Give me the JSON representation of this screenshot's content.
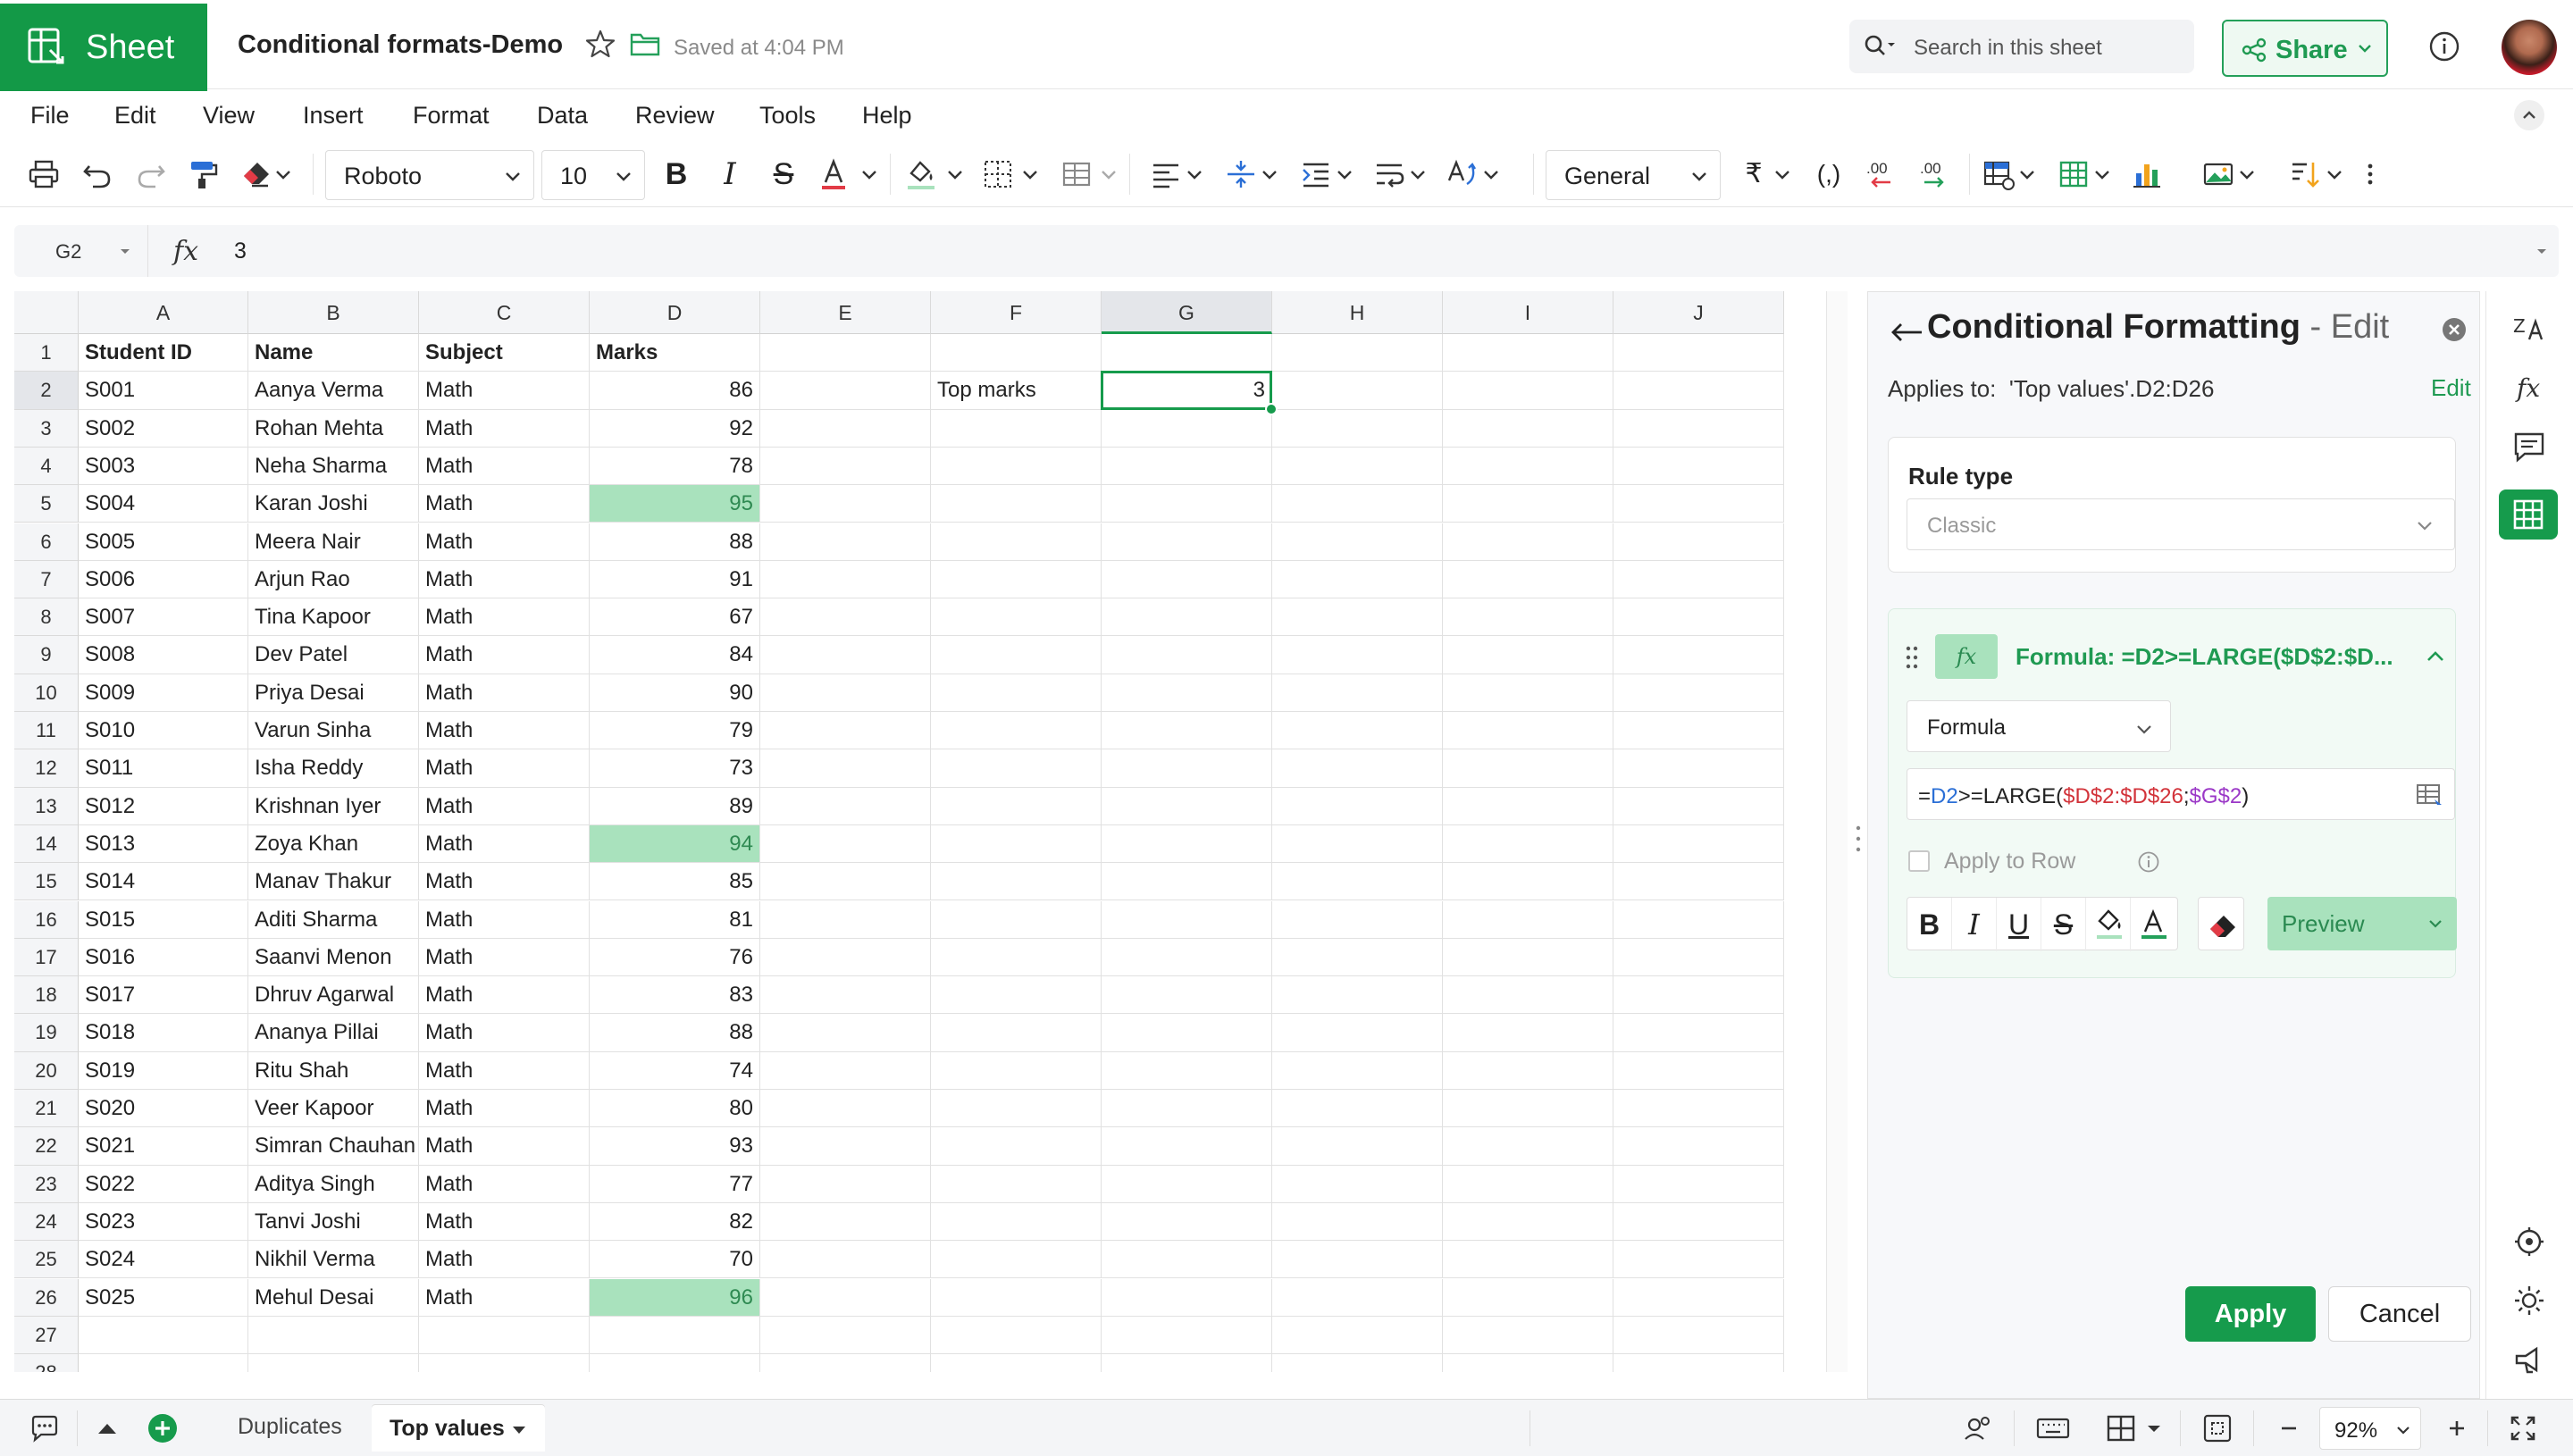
{
  "app": {
    "name": "Sheet",
    "doc_title": "Conditional formats-Demo",
    "saved_status": "Saved at 4:04 PM"
  },
  "search": {
    "placeholder": "Search in this sheet"
  },
  "share": {
    "label": "Share"
  },
  "menu": [
    "File",
    "Edit",
    "View",
    "Insert",
    "Format",
    "Data",
    "Review",
    "Tools",
    "Help"
  ],
  "toolbar": {
    "font": "Roboto",
    "font_size": "10",
    "number_format": "General"
  },
  "formula_bar": {
    "cell_ref": "G2",
    "fx": "fx",
    "value": "3"
  },
  "grid": {
    "columns": [
      "A",
      "B",
      "C",
      "D",
      "E",
      "F",
      "G",
      "H",
      "I",
      "J"
    ],
    "headers": [
      "Student ID",
      "Name",
      "Subject",
      "Marks"
    ],
    "rows": [
      [
        "S001",
        "Aanya Verma",
        "Math",
        "86"
      ],
      [
        "S002",
        "Rohan Mehta",
        "Math",
        "92"
      ],
      [
        "S003",
        "Neha Sharma",
        "Math",
        "78"
      ],
      [
        "S004",
        "Karan Joshi",
        "Math",
        "95"
      ],
      [
        "S005",
        "Meera Nair",
        "Math",
        "88"
      ],
      [
        "S006",
        "Arjun Rao",
        "Math",
        "91"
      ],
      [
        "S007",
        "Tina Kapoor",
        "Math",
        "67"
      ],
      [
        "S008",
        "Dev Patel",
        "Math",
        "84"
      ],
      [
        "S009",
        "Priya Desai",
        "Math",
        "90"
      ],
      [
        "S010",
        "Varun Sinha",
        "Math",
        "79"
      ],
      [
        "S011",
        "Isha Reddy",
        "Math",
        "73"
      ],
      [
        "S012",
        "Krishnan Iyer",
        "Math",
        "89"
      ],
      [
        "S013",
        "Zoya Khan",
        "Math",
        "94"
      ],
      [
        "S014",
        "Manav Thakur",
        "Math",
        "85"
      ],
      [
        "S015",
        "Aditi Sharma",
        "Math",
        "81"
      ],
      [
        "S016",
        "Saanvi Menon",
        "Math",
        "76"
      ],
      [
        "S017",
        "Dhruv Agarwal",
        "Math",
        "83"
      ],
      [
        "S018",
        "Ananya Pillai",
        "Math",
        "88"
      ],
      [
        "S019",
        "Ritu Shah",
        "Math",
        "74"
      ],
      [
        "S020",
        "Veer Kapoor",
        "Math",
        "80"
      ],
      [
        "S021",
        "Simran Chauhan",
        "Math",
        "93"
      ],
      [
        "S022",
        "Aditya Singh",
        "Math",
        "77"
      ],
      [
        "S023",
        "Tanvi Joshi",
        "Math",
        "82"
      ],
      [
        "S024",
        "Nikhil Verma",
        "Math",
        "70"
      ],
      [
        "S025",
        "Mehul Desai",
        "Math",
        "96"
      ]
    ],
    "highlighted_rows": [
      4,
      13,
      25
    ],
    "highlight_color": "#a9e2bd",
    "f2_label": "Top marks",
    "g2_value": "3",
    "selected_cell": "G2"
  },
  "panel": {
    "title": "Conditional Formatting",
    "title_suffix": "- Edit",
    "applies_to_label": "Applies to:",
    "applies_to_value": "'Top values'.D2:D26",
    "applies_edit": "Edit",
    "rule_type_label": "Rule type",
    "rule_type_value": "Classic",
    "rule_badge": "fx",
    "rule_name": "Formula: =D2>=LARGE($D$2:$D...",
    "condition_type": "Formula",
    "formula_parts": {
      "p1": "=",
      "p2": "D2",
      "p3": ">=LARGE(",
      "p4": "$D$2:$D$26",
      "p5": ";",
      "p6": "$G$2",
      "p7": ")"
    },
    "apply_to_row_label": "Apply to Row",
    "format_tools": [
      "B",
      "I",
      "U",
      "S"
    ],
    "preview_label": "Preview",
    "apply_button": "Apply",
    "cancel_button": "Cancel"
  },
  "sheet_tabs": [
    "Duplicates",
    "Top values"
  ],
  "active_tab": "Top values",
  "zoom": "92%",
  "colors": {
    "brand_green": "#139947",
    "accent_green": "#1f9a52",
    "highlight_green": "#a9e2bd"
  }
}
